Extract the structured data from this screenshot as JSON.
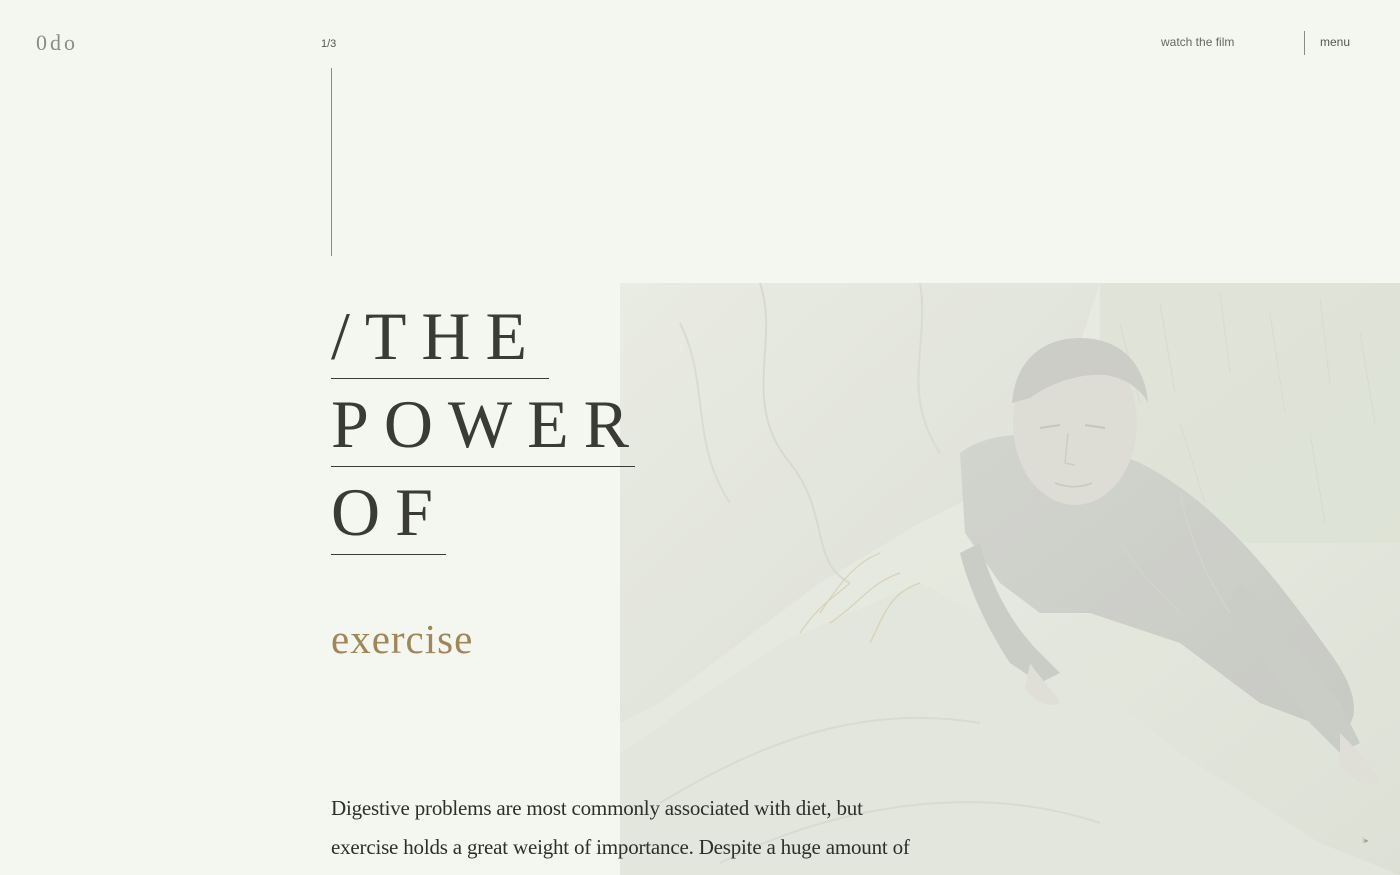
{
  "header": {
    "logo": "0do",
    "slide_counter": "1/3",
    "watch_film_label": "watch the film",
    "menu_label": "menu"
  },
  "hero": {
    "title_lines": [
      "/THE",
      "POWER",
      "OF"
    ],
    "subtitle": "exercise",
    "body": "Digestive problems are most commonly associated with diet, but exercise holds a great weight of importance. Despite a huge amount of fear and confusion surrounding my own condition, I",
    "photo_icon": "man-climbing-rocks-photo",
    "play_glyph": "⁝▸"
  },
  "colors": {
    "background": "#f4f7ef",
    "text": "#2e2e2b",
    "accent": "#a08658",
    "muted": "#8a8c86"
  }
}
